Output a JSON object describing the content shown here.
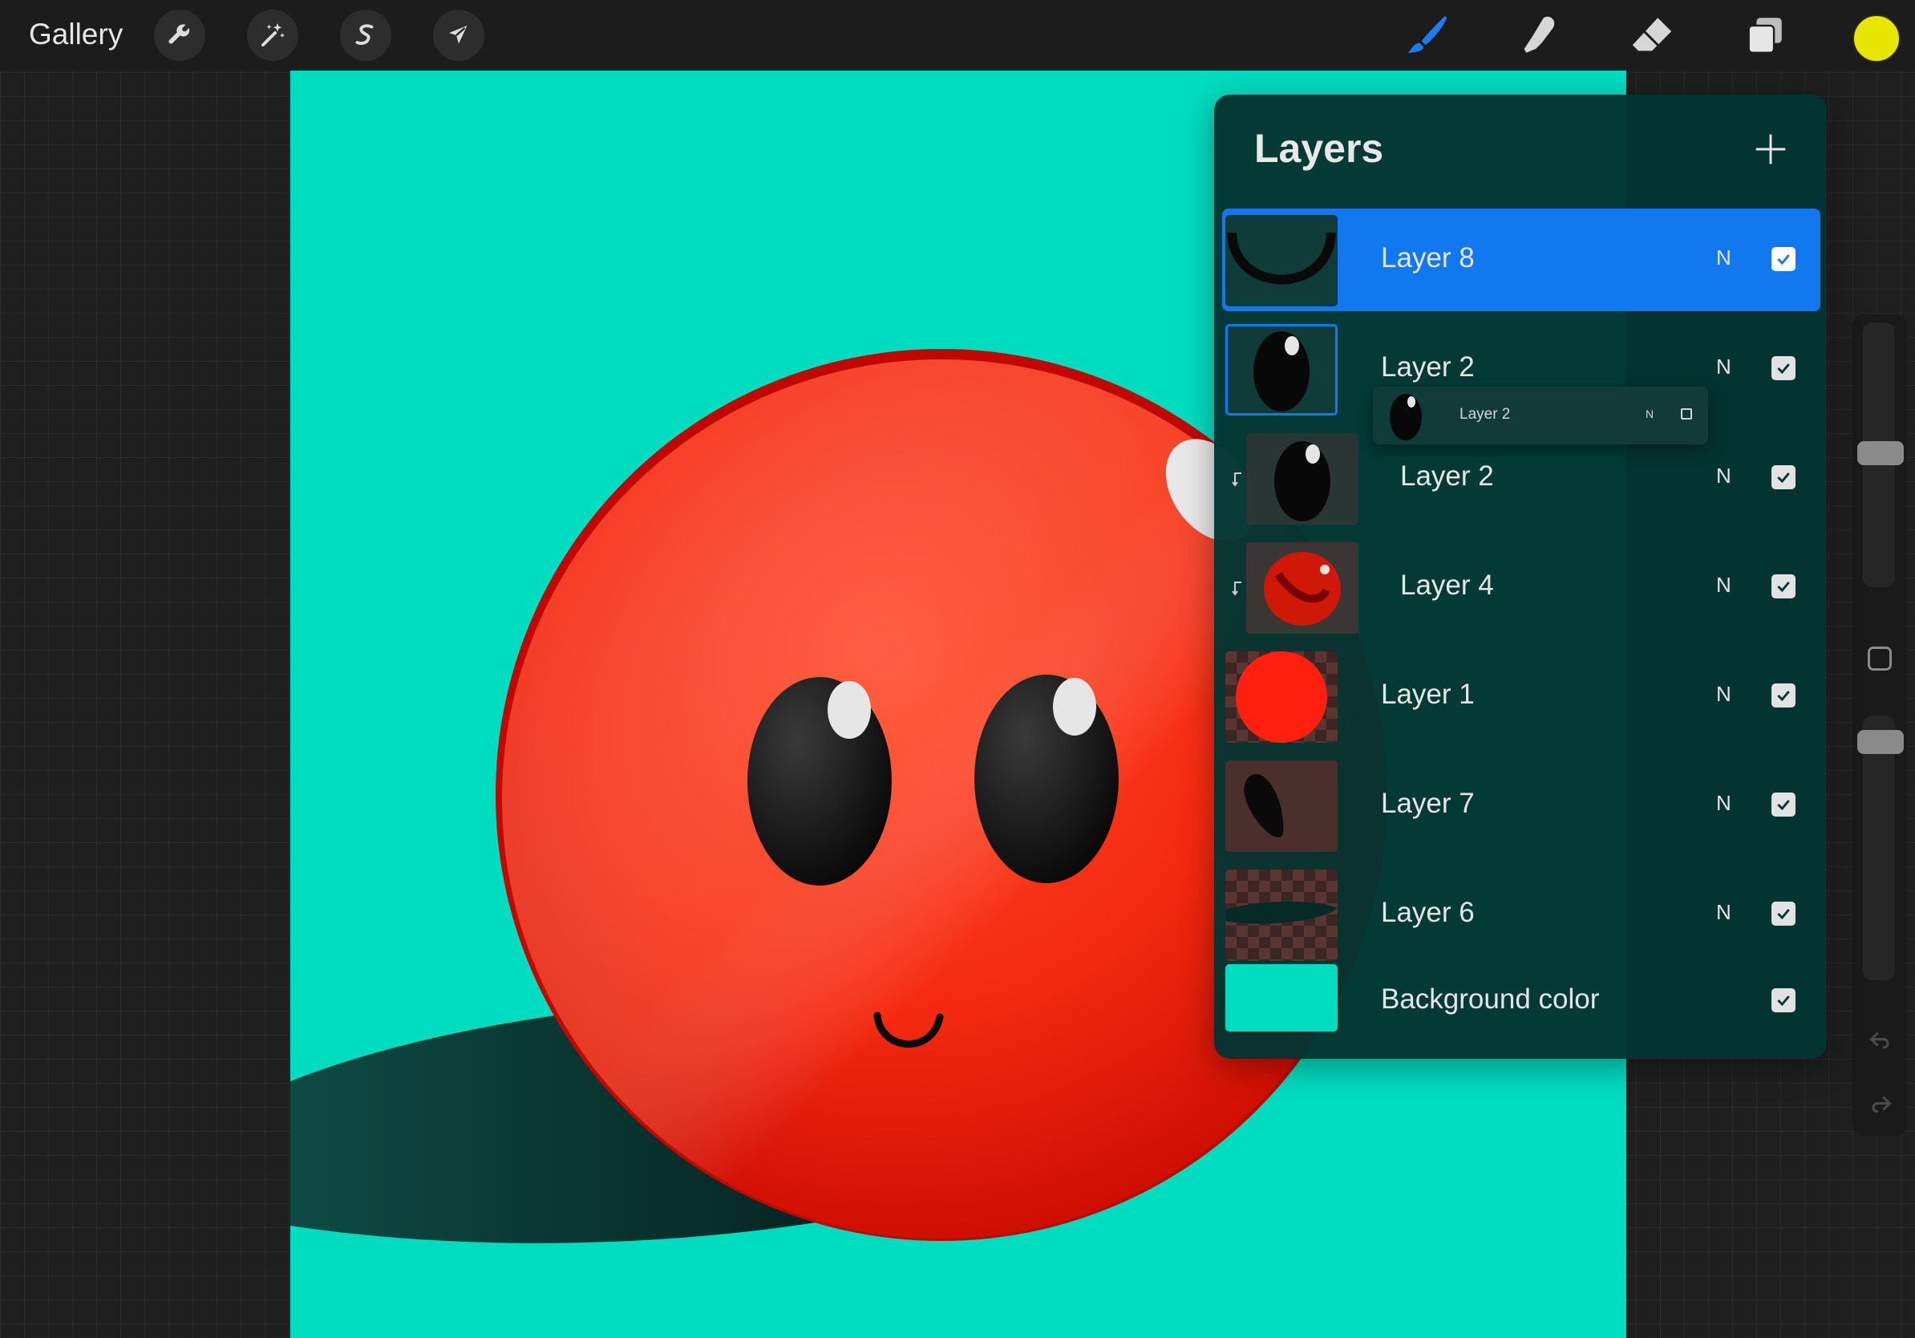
{
  "toolbar": {
    "gallery_label": "Gallery",
    "left_tools": [
      "wrench-icon",
      "magic-wand-icon",
      "selection-s-icon",
      "transform-arrow-icon"
    ],
    "right_tools": [
      "brush-icon",
      "smudge-icon",
      "eraser-icon",
      "layers-icon"
    ],
    "active_tool": "brush-icon",
    "accent_color": "#1278f0",
    "current_color": "#e8e600"
  },
  "canvas": {
    "background_color": "#00dcc0",
    "subject": "red ball character with two eyes and a smile, dark shadow"
  },
  "layers_panel": {
    "title": "Layers",
    "add_icon": "plus-icon",
    "layers": [
      {
        "name": "Layer 8",
        "blend": "N",
        "visible": true,
        "selected": true,
        "clipped": false,
        "thumb": "smile-arc"
      },
      {
        "name": "Layer 2",
        "blend": "N",
        "visible": true,
        "selected": false,
        "clipped": false,
        "thumb": "eye"
      },
      {
        "name": "Layer 2",
        "blend": "N",
        "visible": true,
        "selected": false,
        "clipped": true,
        "thumb": "eye"
      },
      {
        "name": "Layer 4",
        "blend": "N",
        "visible": true,
        "selected": false,
        "clipped": true,
        "thumb": "red-shading"
      },
      {
        "name": "Layer 1",
        "blend": "N",
        "visible": true,
        "selected": false,
        "clipped": false,
        "thumb": "red-circle"
      },
      {
        "name": "Layer 7",
        "blend": "N",
        "visible": true,
        "selected": false,
        "clipped": false,
        "thumb": "dark-blob"
      },
      {
        "name": "Layer 6",
        "blend": "N",
        "visible": true,
        "selected": false,
        "clipped": false,
        "thumb": "shadow-ellipse"
      },
      {
        "name": "Background color",
        "blend": "",
        "visible": true,
        "selected": false,
        "clipped": false,
        "thumb": "teal-fill"
      }
    ],
    "drag_ghost": {
      "name": "Layer 2",
      "blend": "N",
      "visible": false
    }
  },
  "sidebar": {
    "brush_size_level": 0.4,
    "opacity_level": 0.95,
    "undo_icon": "undo-icon",
    "redo_icon": "redo-icon"
  }
}
